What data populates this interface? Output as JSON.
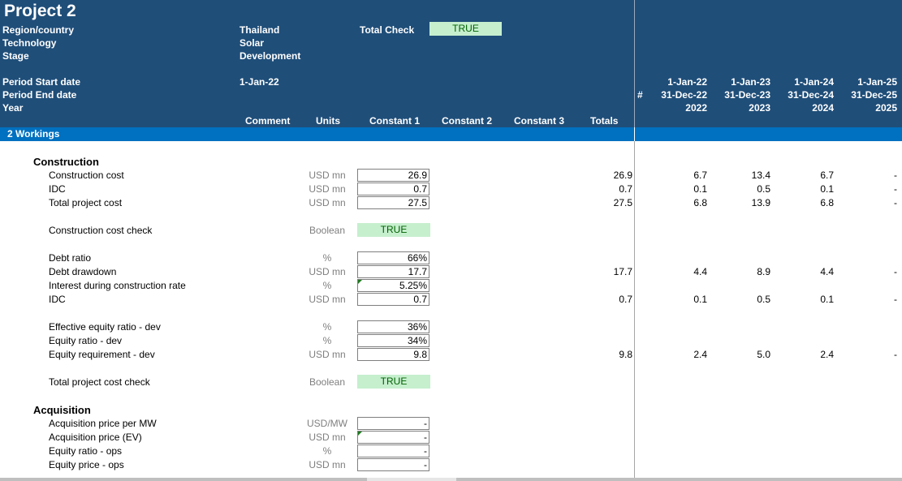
{
  "header": {
    "project_title": "Project 2",
    "labels": [
      "Region/country",
      "Technology",
      "Stage"
    ],
    "values": [
      "Thailand",
      "Solar",
      "Development"
    ],
    "total_check_label": "Total Check",
    "total_check_value": "TRUE",
    "period_labels": [
      "Period Start date",
      "Period End date",
      "Year"
    ],
    "period_start": "1-Jan-22",
    "hash": "#",
    "col_headers": [
      "Comment",
      "Units",
      "Constant 1",
      "Constant 2",
      "Constant 3",
      "Totals"
    ],
    "periods": [
      {
        "start": "1-Jan-22",
        "end": "31-Dec-22",
        "year": "2022"
      },
      {
        "start": "1-Jan-23",
        "end": "31-Dec-23",
        "year": "2023"
      },
      {
        "start": "1-Jan-24",
        "end": "31-Dec-24",
        "year": "2024"
      },
      {
        "start": "1-Jan-25",
        "end": "31-Dec-25",
        "year": "2025"
      }
    ]
  },
  "section_title": "2 Workings",
  "groups": {
    "construction": "Construction",
    "acquisition": "Acquisition"
  },
  "rows": {
    "construction_cost": {
      "label": "Construction cost",
      "unit": "USD mn",
      "const": "26.9",
      "total": "26.9",
      "p": [
        "6.7",
        "13.4",
        "6.7",
        "-"
      ]
    },
    "idc1": {
      "label": "IDC",
      "unit": "USD mn",
      "const": "0.7",
      "total": "0.7",
      "p": [
        "0.1",
        "0.5",
        "0.1",
        "-"
      ]
    },
    "total_project_cost": {
      "label": "Total project cost",
      "unit": "USD mn",
      "const": "27.5",
      "total": "27.5",
      "p": [
        "6.8",
        "13.9",
        "6.8",
        "-"
      ]
    },
    "construction_cost_check": {
      "label": "Construction cost check",
      "unit": "Boolean",
      "const": "TRUE"
    },
    "debt_ratio": {
      "label": "Debt ratio",
      "unit": "%",
      "const": "66%"
    },
    "debt_drawdown": {
      "label": "Debt drawdown",
      "unit": "USD mn",
      "const": "17.7",
      "total": "17.7",
      "p": [
        "4.4",
        "8.9",
        "4.4",
        "-"
      ]
    },
    "interest_rate": {
      "label": "Interest during construction rate",
      "unit": "%",
      "const": "5.25%"
    },
    "idc2": {
      "label": "IDC",
      "unit": "USD mn",
      "const": "0.7",
      "total": "0.7",
      "p": [
        "0.1",
        "0.5",
        "0.1",
        "-"
      ]
    },
    "eff_equity_ratio": {
      "label": "Effective equity ratio - dev",
      "unit": "%",
      "const": "36%"
    },
    "equity_ratio_dev": {
      "label": "Equity ratio - dev",
      "unit": "%",
      "const": "34%"
    },
    "equity_req_dev": {
      "label": "Equity requirement - dev",
      "unit": "USD mn",
      "const": "9.8",
      "total": "9.8",
      "p": [
        "2.4",
        "5.0",
        "2.4",
        "-"
      ]
    },
    "total_cost_check": {
      "label": "Total project cost check",
      "unit": "Boolean",
      "const": "TRUE"
    },
    "acq_price_mw": {
      "label": "Acquisition price per MW",
      "unit": "USD/MW",
      "const": "-"
    },
    "acq_price_ev": {
      "label": "Acquisition price (EV)",
      "unit": "USD mn",
      "const": "-"
    },
    "equity_ratio_ops": {
      "label": "Equity ratio - ops",
      "unit": "%",
      "const": "-"
    },
    "equity_price_ops": {
      "label": "Equity price - ops",
      "unit": "USD mn",
      "const": "-"
    }
  },
  "colors": {
    "header_bg": "#1f4e79",
    "section_bg": "#0070c0",
    "check_bg": "#c6efce",
    "check_text": "#006100"
  }
}
